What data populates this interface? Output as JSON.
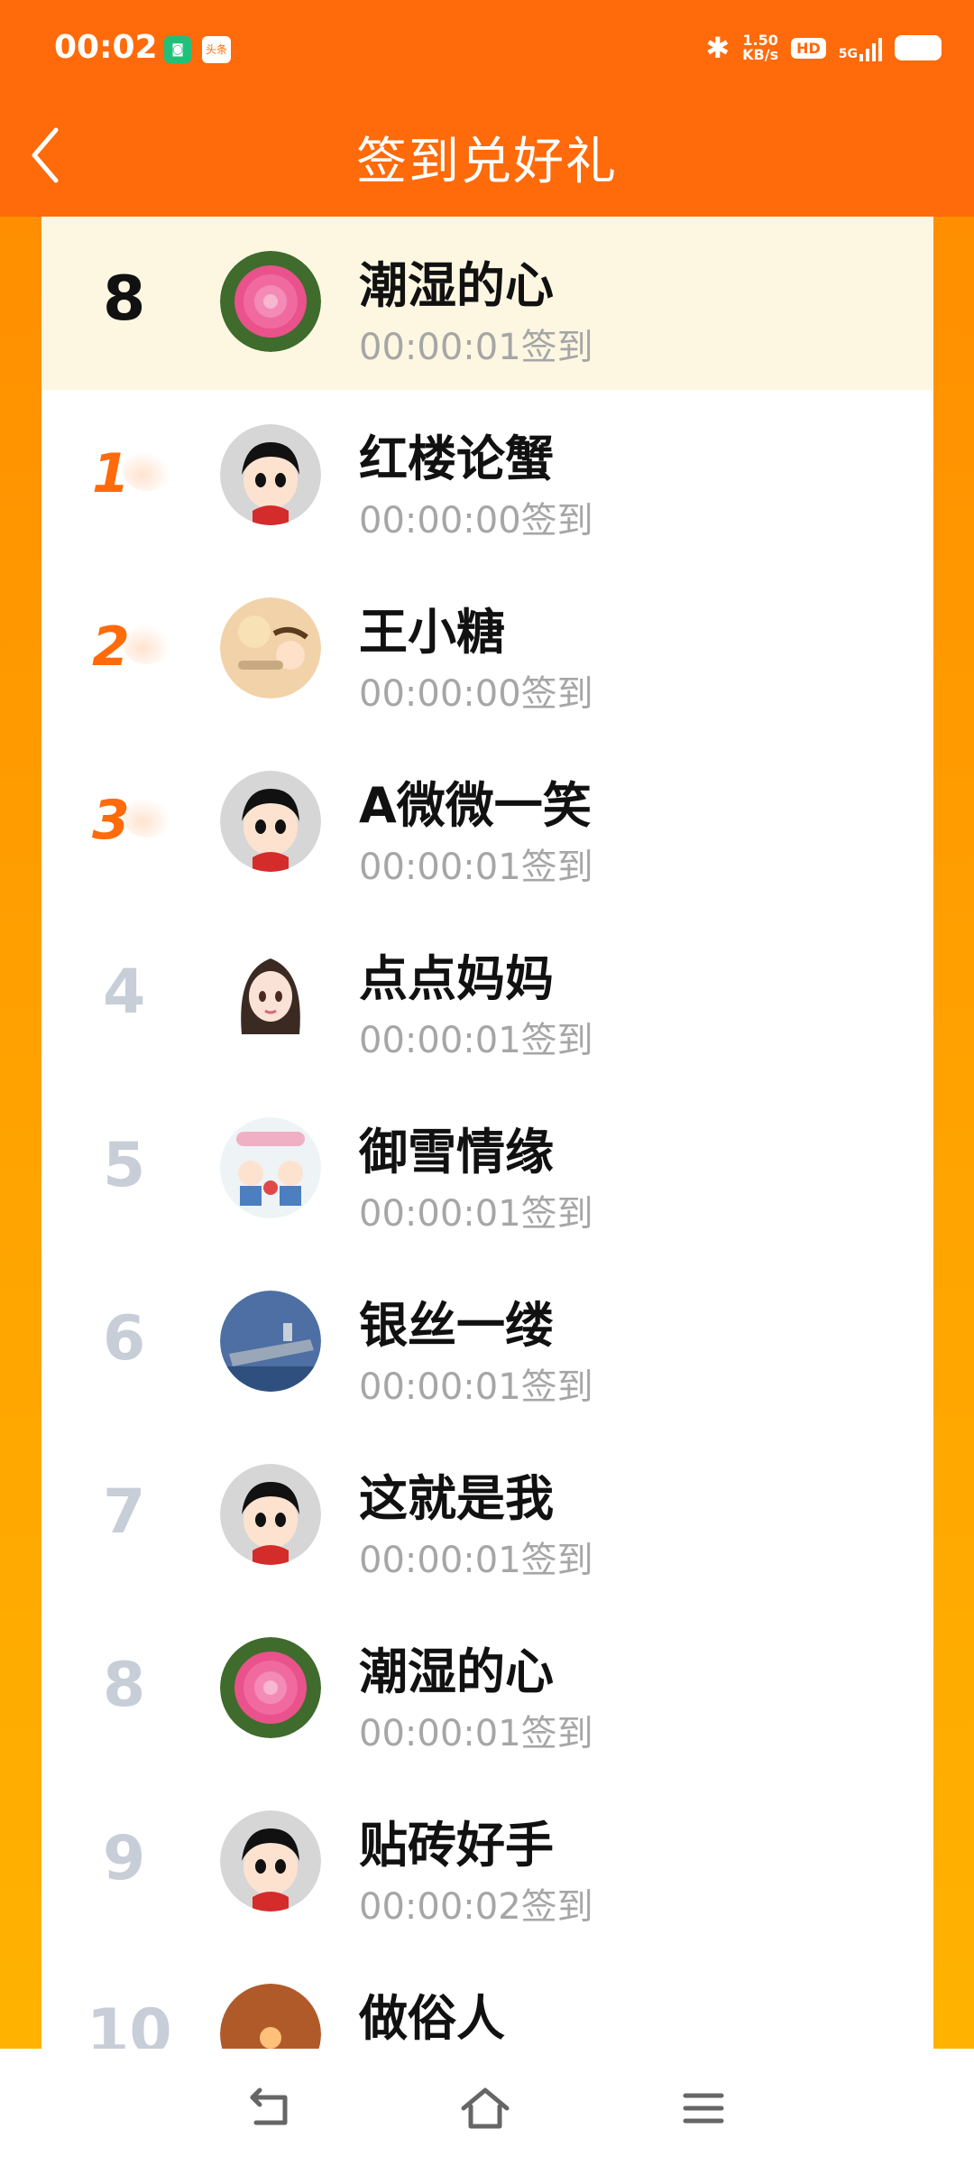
{
  "status_bar": {
    "time": "00:02",
    "speed_value": "1.50",
    "speed_unit": "KB/s",
    "hd": "HD",
    "network": "5G",
    "icon_news": "头条"
  },
  "header": {
    "title": "签到兑好礼"
  },
  "colors": {
    "header": "#ff6a0a",
    "rank_top": "#ff6a0a",
    "rank_normal": "#c7ced8",
    "highlight_row": "#fdf7e2",
    "time_text": "#a6a6a6"
  },
  "rows": [
    {
      "rank": "8",
      "name": "潮湿的心",
      "time": "00:00:01签到",
      "avatar": "flower-avatar",
      "style": "me"
    },
    {
      "rank": "1",
      "name": "红楼论蟹",
      "time": "00:00:00签到",
      "avatar": "cartoon-boy-avatar",
      "style": "top"
    },
    {
      "rank": "2",
      "name": "王小糖",
      "time": "00:00:00签到",
      "avatar": "illustration-avatar",
      "style": "top"
    },
    {
      "rank": "3",
      "name": "A微微一笑",
      "time": "00:00:01签到",
      "avatar": "cartoon-boy-avatar",
      "style": "top"
    },
    {
      "rank": "4",
      "name": "点点妈妈",
      "time": "00:00:01签到",
      "avatar": "girl-avatar",
      "style": "normal"
    },
    {
      "rank": "5",
      "name": "御雪情缘",
      "time": "00:00:01签到",
      "avatar": "couple-avatar",
      "style": "normal"
    },
    {
      "rank": "6",
      "name": "银丝一缕",
      "time": "00:00:01签到",
      "avatar": "ship-avatar",
      "style": "normal"
    },
    {
      "rank": "7",
      "name": "这就是我",
      "time": "00:00:01签到",
      "avatar": "cartoon-boy-avatar",
      "style": "normal"
    },
    {
      "rank": "8",
      "name": "潮湿的心",
      "time": "00:00:01签到",
      "avatar": "flower-avatar",
      "style": "normal"
    },
    {
      "rank": "9",
      "name": "贴砖好手",
      "time": "00:00:02签到",
      "avatar": "cartoon-boy-avatar",
      "style": "normal"
    },
    {
      "rank": "10",
      "name": "做俗人",
      "time": "",
      "avatar": "sunset-avatar",
      "style": "normal"
    }
  ],
  "bottom_nav": [
    "back-nav-icon",
    "home-nav-icon",
    "menu-nav-icon"
  ]
}
